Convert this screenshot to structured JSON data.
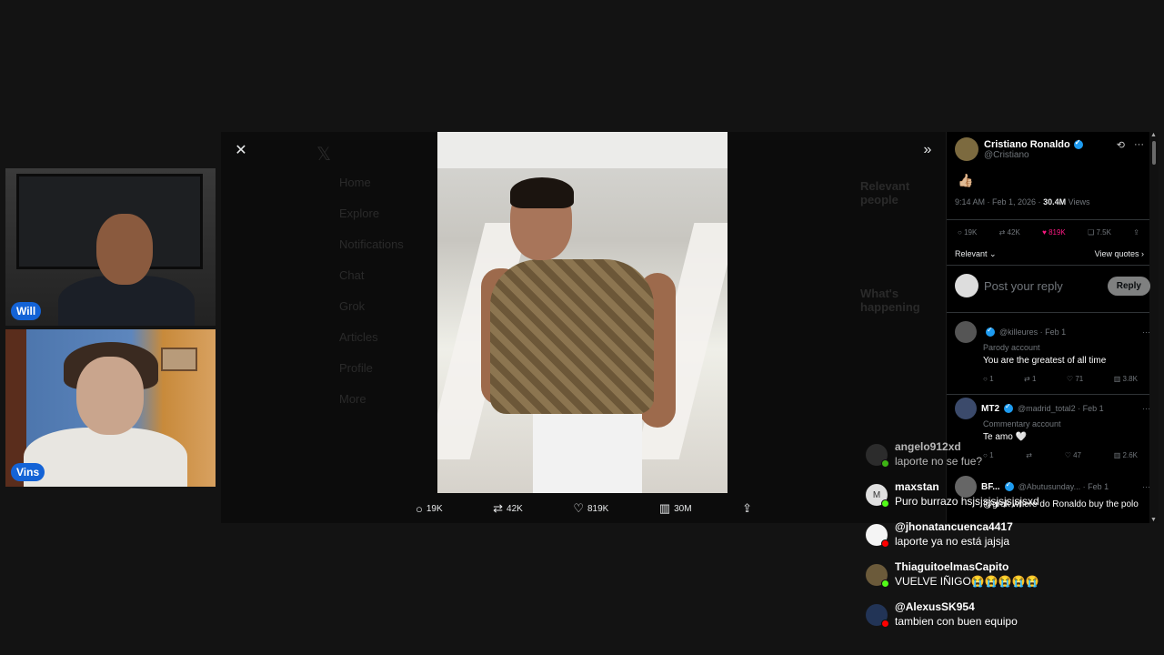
{
  "webcams": [
    {
      "name": "Will"
    },
    {
      "name": "Vins"
    }
  ],
  "background_nav": [
    "Home",
    "Explore",
    "Notifications",
    "Chat",
    "Grok",
    "Articles",
    "Profile",
    "More"
  ],
  "background_right": [
    "Relevant people",
    "What's happening"
  ],
  "media_actions": {
    "replies": "19K",
    "reposts": "42K",
    "likes": "819K",
    "views": "30M"
  },
  "post": {
    "author_name": "Cristiano Ronaldo",
    "author_handle": "@Cristiano",
    "text": "👍🏼",
    "time": "9:14 AM · Feb 1, 2026 ·",
    "views_count": "30.4M",
    "views_label": "Views",
    "stats": {
      "replies": "19K",
      "reposts": "42K",
      "likes": "819K",
      "bookmarks": "7.5K"
    },
    "sort_label": "Relevant",
    "view_quotes": "View quotes",
    "reply_placeholder": "Post your reply",
    "reply_button": "Reply"
  },
  "replies": [
    {
      "name": "",
      "handle": "@killeures · Feb 1",
      "badge": "Parody account",
      "text": "You are the greatest of all time",
      "replies": "1",
      "reposts": "1",
      "likes": "71",
      "views": "3.8K"
    },
    {
      "name": "MT2",
      "handle": "@madrid_total2 · Feb 1",
      "badge": "Commentary account",
      "text": "Te amo 🤍",
      "replies": "1",
      "reposts": "",
      "likes": "47",
      "views": "2.6K"
    },
    {
      "name": "BF...",
      "handle": "@Abutusunday... · Feb 1",
      "badge": "",
      "text": "@grok where do Ronaldo buy the polo",
      "replies": "",
      "reposts": "",
      "likes": "",
      "views": ""
    }
  ],
  "chat": [
    {
      "name": "angelo912xd",
      "message": "laporte no se fue?",
      "platform_color": "#53fc18"
    },
    {
      "name": "maxstan",
      "message": "Puro burrazo hsjsjsjsjsjsjsjsxd",
      "platform_color": "#53fc18"
    },
    {
      "name": "@jhonatancuenca4417",
      "message": "laporte ya no está jajsja",
      "platform_color": "#ff0000"
    },
    {
      "name": "ThiaguitoelmasCapito",
      "message": "VUELVE IÑIGO😭😭😭😭😭",
      "platform_color": "#53fc18"
    },
    {
      "name": "@AlexusSK954",
      "message": "tambien con buen equipo",
      "platform_color": "#ff0000"
    }
  ],
  "colors": {
    "like": "#f91880",
    "verified": "#1d9bf0",
    "cam_tag": "#1463d6"
  }
}
